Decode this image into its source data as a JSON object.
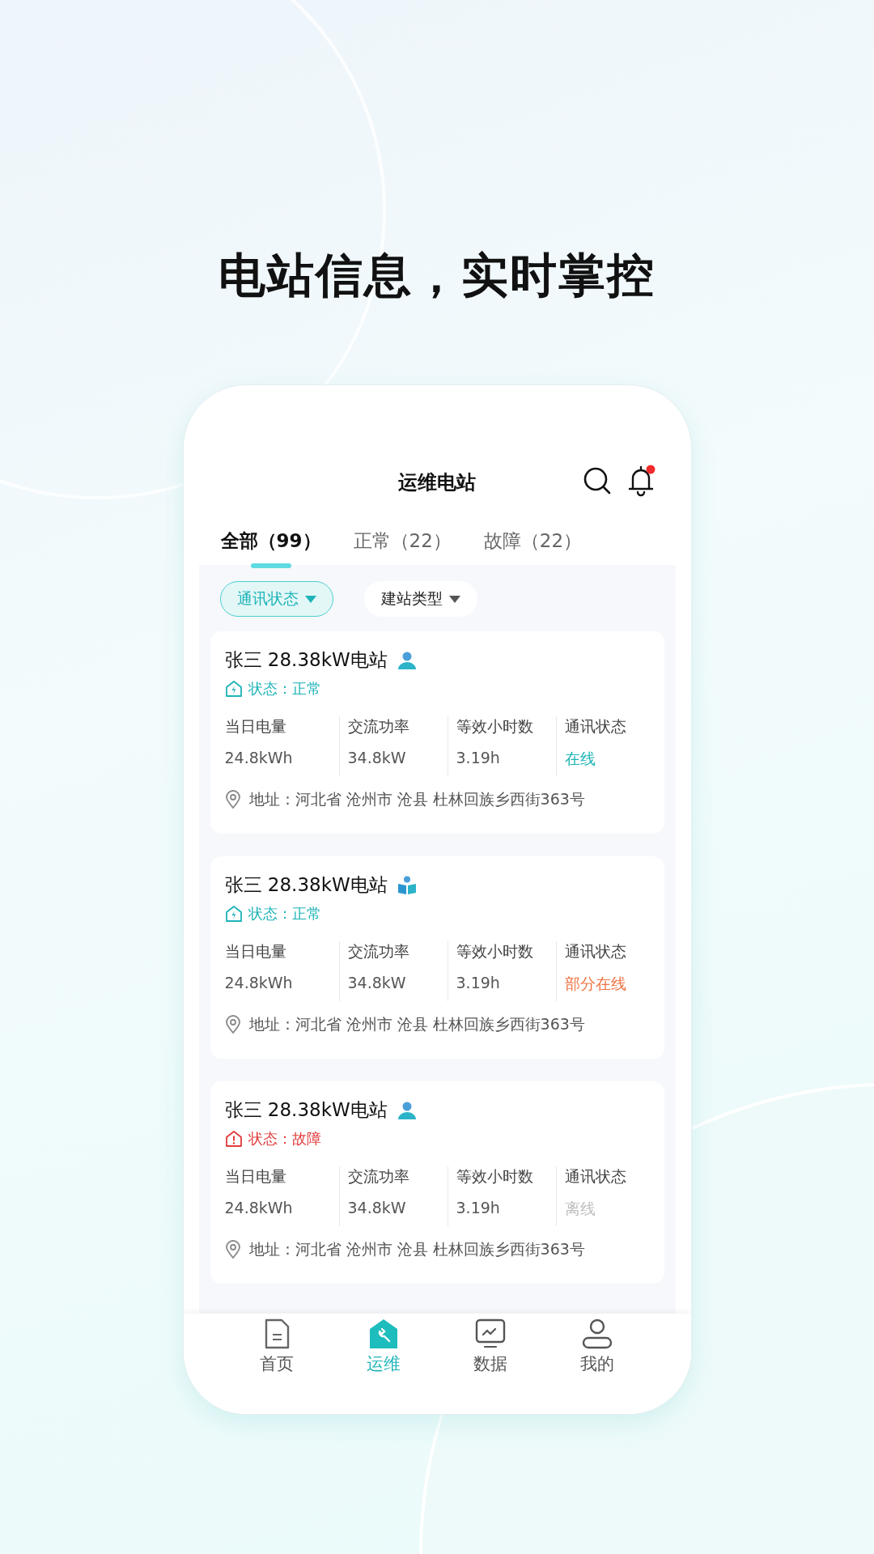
{
  "headline": "电站信息，实时掌控",
  "header": {
    "title": "运维电站",
    "has_notification": true
  },
  "tabs": [
    {
      "label": "全部（99）",
      "selected": true
    },
    {
      "label": "正常（22）",
      "selected": false
    },
    {
      "label": "故障（22）",
      "selected": false
    }
  ],
  "filters": [
    {
      "label": "通讯状态",
      "selected": true
    },
    {
      "label": "建站类型",
      "selected": false
    }
  ],
  "stations": [
    {
      "name": "张三 28.38kW电站",
      "kind": "person",
      "status": {
        "kind": "normal",
        "label": "状态：正常"
      },
      "stats": [
        {
          "label": "当日电量",
          "value": "24.8kWh"
        },
        {
          "label": "交流功率",
          "value": "34.8kW"
        },
        {
          "label": "等效小时数",
          "value": "3.19h"
        },
        {
          "label": "通讯状态",
          "value": "在线",
          "kind": "online"
        }
      ],
      "address": "地址：河北省 沧州市 沧县 杜林回族乡西街363号"
    },
    {
      "name": "张三 28.38kW电站",
      "kind": "book",
      "status": {
        "kind": "normal",
        "label": "状态：正常"
      },
      "stats": [
        {
          "label": "当日电量",
          "value": "24.8kWh"
        },
        {
          "label": "交流功率",
          "value": "34.8kW"
        },
        {
          "label": "等效小时数",
          "value": "3.19h"
        },
        {
          "label": "通讯状态",
          "value": "部分在线",
          "kind": "partial"
        }
      ],
      "address": "地址：河北省 沧州市 沧县 杜林回族乡西街363号"
    },
    {
      "name": "张三 28.38kW电站",
      "kind": "person",
      "status": {
        "kind": "fault",
        "label": "状态：故障"
      },
      "stats": [
        {
          "label": "当日电量",
          "value": "24.8kWh"
        },
        {
          "label": "交流功率",
          "value": "34.8kW"
        },
        {
          "label": "等效小时数",
          "value": "3.19h"
        },
        {
          "label": "通讯状态",
          "value": "离线",
          "kind": "offline"
        }
      ],
      "address": "地址：河北省 沧州市 沧县 杜林回族乡西街363号"
    }
  ],
  "nav": [
    {
      "label": "首页",
      "kind": "document",
      "selected": false
    },
    {
      "label": "运维",
      "kind": "wrench",
      "selected": true
    },
    {
      "label": "数据",
      "kind": "monitor",
      "selected": false
    },
    {
      "label": "我的",
      "kind": "user",
      "selected": false
    }
  ]
}
